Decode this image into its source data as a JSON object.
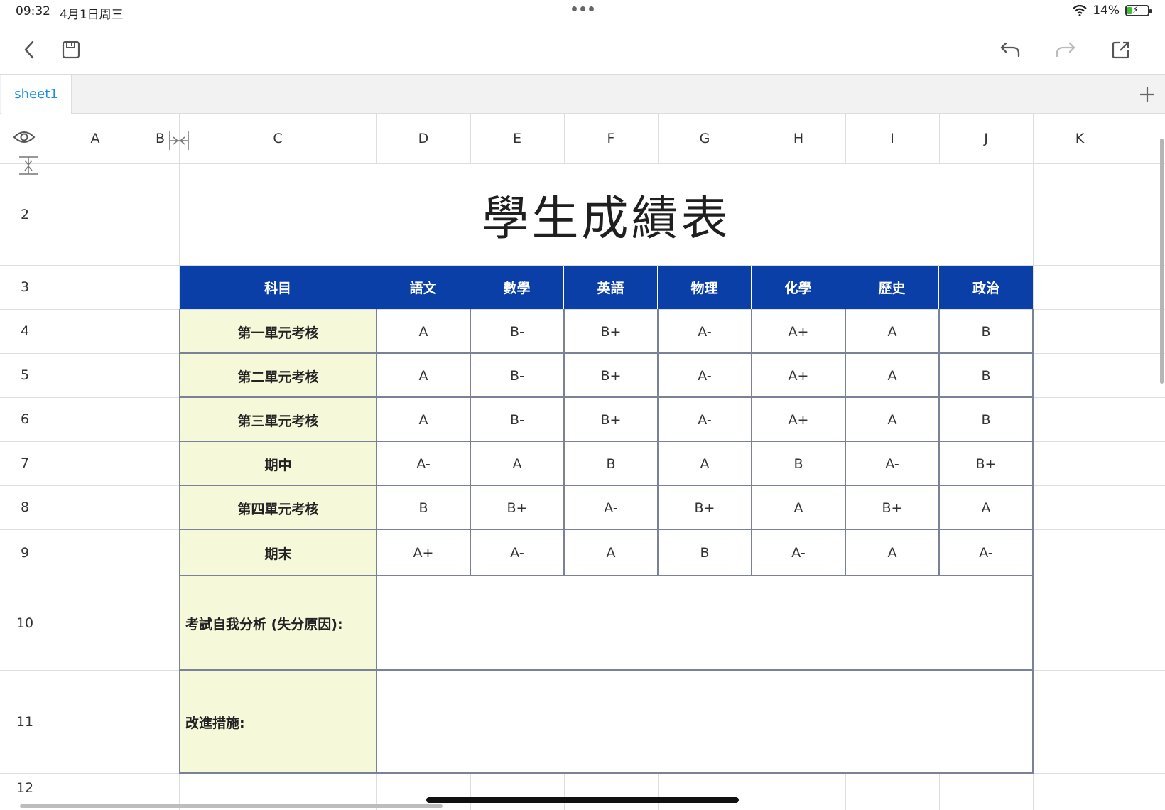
{
  "status": {
    "time": "09:32",
    "date": "4月1日周三",
    "battery": "14%"
  },
  "tabs": [
    {
      "label": "sheet1"
    }
  ],
  "columns": [
    "A",
    "B",
    "C",
    "D",
    "E",
    "F",
    "G",
    "H",
    "I",
    "J",
    "K"
  ],
  "rows": [
    "2",
    "3",
    "4",
    "5",
    "6",
    "7",
    "8",
    "9",
    "10",
    "11",
    "12"
  ],
  "sheet": {
    "title": "學生成績表",
    "header_label": "科目",
    "subjects": [
      "語文",
      "數學",
      "英語",
      "物理",
      "化學",
      "歷史",
      "政治"
    ],
    "records": [
      {
        "name": "第一單元考核",
        "grades": [
          "A",
          "B-",
          "B+",
          "A-",
          "A+",
          "A",
          "B"
        ]
      },
      {
        "name": "第二單元考核",
        "grades": [
          "A",
          "B-",
          "B+",
          "A-",
          "A+",
          "A",
          "B"
        ]
      },
      {
        "name": "第三單元考核",
        "grades": [
          "A",
          "B-",
          "B+",
          "A-",
          "A+",
          "A",
          "B"
        ]
      },
      {
        "name": "期中",
        "grades": [
          "A-",
          "A",
          "B",
          "A",
          "B",
          "A-",
          "B+"
        ]
      },
      {
        "name": "第四單元考核",
        "grades": [
          "B",
          "B+",
          "A-",
          "B+",
          "A",
          "B+",
          "A"
        ]
      },
      {
        "name": "期末",
        "grades": [
          "A+",
          "A-",
          "A",
          "B",
          "A-",
          "A",
          "A-"
        ]
      }
    ],
    "analysis_label": "考試自我分析 (失分原因):",
    "improve_label": "改進措施:"
  },
  "icons": {
    "wifi": "wifi-icon",
    "battery": "battery-icon",
    "back": "chevron-left-icon",
    "save": "save-icon",
    "undo": "undo-icon",
    "redo": "redo-icon",
    "share": "share-icon",
    "add": "plus-icon",
    "visibility": "eye-icon"
  },
  "colors": {
    "header_fill": "#0a3fa8",
    "label_fill": "#f5f8d9",
    "tab_text": "#1a8fe0"
  }
}
